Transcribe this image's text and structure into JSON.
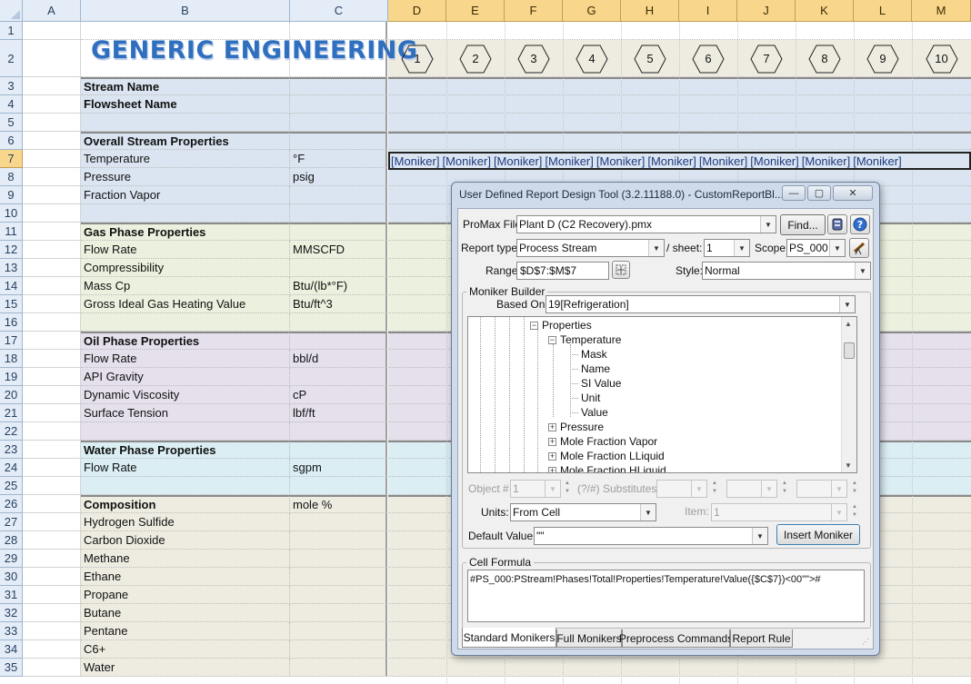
{
  "spreadsheet": {
    "columns": [
      "A",
      "B",
      "C",
      "D",
      "E",
      "F",
      "G",
      "H",
      "I",
      "J",
      "K",
      "L",
      "M"
    ],
    "selected_columns": [
      "D",
      "E",
      "F",
      "G",
      "H",
      "I",
      "J",
      "K",
      "L",
      "M"
    ],
    "selected_row": 7,
    "logo_text": "GENERIC ENGINEERING",
    "stream_numbers": [
      "1",
      "2",
      "3",
      "4",
      "5",
      "6",
      "7",
      "8",
      "9",
      "10"
    ],
    "rows": [
      {
        "num": "1",
        "b": "",
        "c": "",
        "tone": "white",
        "bold": false
      },
      {
        "num": "2",
        "b": "",
        "c": "",
        "tone": "white",
        "bold": false
      },
      {
        "num": "3",
        "b": "Stream Name",
        "c": "",
        "tone": "blue",
        "bold": true
      },
      {
        "num": "4",
        "b": "Flowsheet Name",
        "c": "",
        "tone": "blue",
        "bold": true
      },
      {
        "num": "5",
        "b": "",
        "c": "",
        "tone": "blue",
        "bold": false
      },
      {
        "num": "6",
        "b": "Overall Stream Properties",
        "c": "",
        "tone": "blue",
        "bold": true
      },
      {
        "num": "7",
        "b": "Temperature",
        "c": "°F",
        "tone": "blue",
        "bold": false
      },
      {
        "num": "8",
        "b": "Pressure",
        "c": "psig",
        "tone": "blue",
        "bold": false
      },
      {
        "num": "9",
        "b": "Fraction Vapor",
        "c": "",
        "tone": "blue",
        "bold": false
      },
      {
        "num": "10",
        "b": "",
        "c": "",
        "tone": "blue",
        "bold": false
      },
      {
        "num": "11",
        "b": "Gas Phase Properties",
        "c": "",
        "tone": "green",
        "bold": true
      },
      {
        "num": "12",
        "b": "Flow Rate",
        "c": "MMSCFD",
        "tone": "green",
        "bold": false
      },
      {
        "num": "13",
        "b": "Compressibility",
        "c": "",
        "tone": "green",
        "bold": false
      },
      {
        "num": "14",
        "b": "Mass Cp",
        "c": "Btu/(lb*°F)",
        "tone": "green",
        "bold": false
      },
      {
        "num": "15",
        "b": "Gross Ideal Gas Heating Value",
        "c": "Btu/ft^3",
        "tone": "green",
        "bold": false
      },
      {
        "num": "16",
        "b": "",
        "c": "",
        "tone": "green",
        "bold": false
      },
      {
        "num": "17",
        "b": "Oil Phase Properties",
        "c": "",
        "tone": "purple",
        "bold": true
      },
      {
        "num": "18",
        "b": "Flow Rate",
        "c": "bbl/d",
        "tone": "purple",
        "bold": false
      },
      {
        "num": "19",
        "b": "API Gravity",
        "c": "",
        "tone": "purple",
        "bold": false
      },
      {
        "num": "20",
        "b": "Dynamic Viscosity",
        "c": "cP",
        "tone": "purple",
        "bold": false
      },
      {
        "num": "21",
        "b": "Surface Tension",
        "c": "lbf/ft",
        "tone": "purple",
        "bold": false
      },
      {
        "num": "22",
        "b": "",
        "c": "",
        "tone": "purple",
        "bold": false
      },
      {
        "num": "23",
        "b": "Water Phase Properties",
        "c": "",
        "tone": "cyan",
        "bold": true
      },
      {
        "num": "24",
        "b": "Flow Rate",
        "c": "sgpm",
        "tone": "cyan",
        "bold": false
      },
      {
        "num": "25",
        "b": "",
        "c": "",
        "tone": "cyan",
        "bold": false
      },
      {
        "num": "26",
        "b": "Composition",
        "c": "mole %",
        "tone": "tan",
        "bold": true
      },
      {
        "num": "27",
        "b": "Hydrogen Sulfide",
        "c": "",
        "tone": "tan",
        "bold": false
      },
      {
        "num": "28",
        "b": "Carbon Dioxide",
        "c": "",
        "tone": "tan",
        "bold": false
      },
      {
        "num": "29",
        "b": "Methane",
        "c": "",
        "tone": "tan",
        "bold": false
      },
      {
        "num": "30",
        "b": "Ethane",
        "c": "",
        "tone": "tan",
        "bold": false
      },
      {
        "num": "31",
        "b": "Propane",
        "c": "",
        "tone": "tan",
        "bold": false
      },
      {
        "num": "32",
        "b": "Butane",
        "c": "",
        "tone": "tan",
        "bold": false
      },
      {
        "num": "33",
        "b": "Pentane",
        "c": "",
        "tone": "tan",
        "bold": false
      },
      {
        "num": "34",
        "b": "C6+",
        "c": "",
        "tone": "tan",
        "bold": false
      },
      {
        "num": "35",
        "b": "Water",
        "c": "",
        "tone": "tan",
        "bold": false
      }
    ],
    "moniker_cells": [
      "[Moniker]",
      "[Moniker]",
      "[Moniker]",
      "[Moniker]",
      "[Moniker]",
      "[Moniker]",
      "[Moniker]",
      "[Moniker]",
      "[Moniker]",
      "[Moniker]"
    ]
  },
  "dialog": {
    "title": "User Defined Report Design Tool (3.2.11188.0) - CustomReportBl...",
    "minimize_symbol": "—",
    "maximize_symbol": "▢",
    "close_symbol": "✕",
    "promax_file_label": "ProMax File:",
    "promax_file_value": "Plant D (C2 Recovery).pmx",
    "find_button": "Find...",
    "info_icon": "database-icon",
    "help_icon": "help-icon",
    "report_type_label": "Report type:",
    "report_type_value": "Process Stream",
    "sheet_label": "/ sheet:",
    "sheet_value": "1",
    "scope_label": "Scope:",
    "scope_value": "PS_000",
    "telescope_icon": "telescope-icon",
    "range_label": "Range:",
    "range_value": "$D$7:$M$7",
    "style_label": "Style:",
    "style_value": "Normal",
    "moniker_builder_legend": "Moniker Builder",
    "based_on_label": "Based On:",
    "based_on_value": "19[Refrigeration]",
    "tree": {
      "properties": "Properties",
      "temperature": "Temperature",
      "mask": "Mask",
      "name": "Name",
      "si_value": "SI Value",
      "unit": "Unit",
      "value": "Value",
      "pressure": "Pressure",
      "mole_fraction_vapor": "Mole Fraction Vapor",
      "mole_fraction_lliquid": "Mole Fraction LLiquid",
      "mole_fraction_hliquid": "Mole Fraction HLiquid"
    },
    "object_label": "Object #",
    "object_value": "1",
    "substitutes_label": "(?/#) Substitutes:",
    "units_label": "Units:",
    "units_value": "From Cell",
    "item_label": "Item:",
    "item_value": "1",
    "default_value_label": "Default Value:",
    "default_value_value": "\"\"",
    "insert_moniker_button": "Insert Moniker",
    "cell_formula_legend": "Cell Formula",
    "cell_formula_value": "#PS_000:PStream!Phases!Total!Properties!Temperature!Value({$C$7})<00\"\">#",
    "tabs": [
      "Standard Monikers",
      "Full Monikers",
      "Preprocess Commands",
      "Report Rule"
    ],
    "active_tab": "Standard Monikers"
  },
  "colors": {
    "tone_blue": "#dbe5f1",
    "tone_green": "#ebf1de",
    "tone_purple": "#e5e0ec",
    "tone_cyan": "#daeef3",
    "tone_tan": "#eeece1",
    "header_selected": "#f8d68b",
    "logo_blue": "#2f6fbf",
    "dialog_frame": "#cfdbea"
  }
}
